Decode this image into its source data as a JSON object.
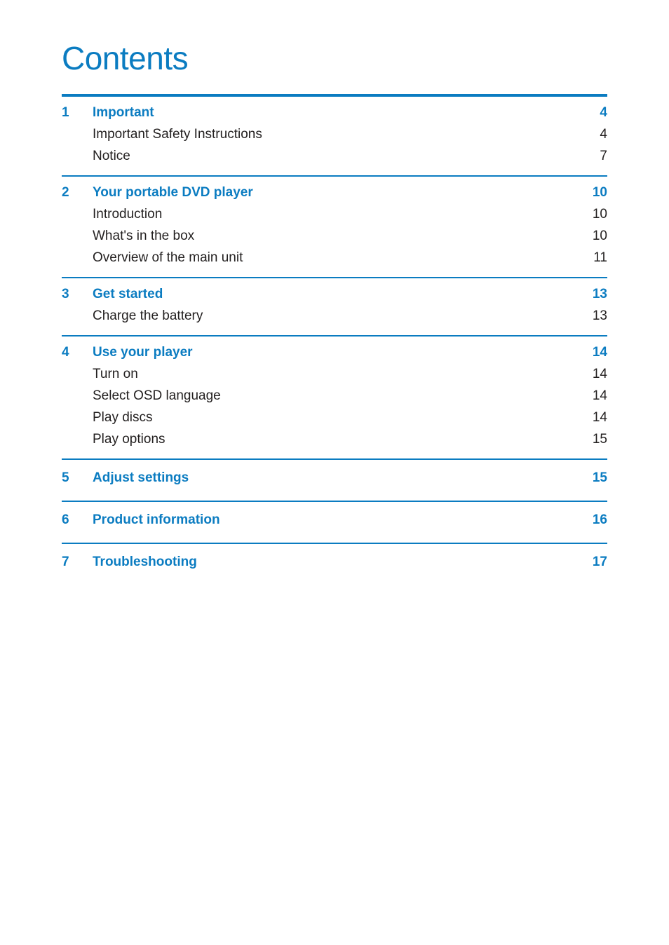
{
  "document": {
    "title": "Contents",
    "accent_color": "#0b7cc1",
    "body_text_color": "#221f1f"
  },
  "toc": {
    "sections": [
      {
        "number": "1",
        "title": "Important",
        "page": "4",
        "items": [
          {
            "label": "Important Safety Instructions",
            "page": "4"
          },
          {
            "label": "Notice",
            "page": "7"
          }
        ]
      },
      {
        "number": "2",
        "title": "Your portable DVD player",
        "page": "10",
        "items": [
          {
            "label": "Introduction",
            "page": "10"
          },
          {
            "label": "What's in the box",
            "page": "10"
          },
          {
            "label": "Overview of the main unit",
            "page": "11"
          }
        ]
      },
      {
        "number": "3",
        "title": "Get started",
        "page": "13",
        "items": [
          {
            "label": "Charge the battery",
            "page": "13"
          }
        ]
      },
      {
        "number": "4",
        "title": "Use your player",
        "page": "14",
        "items": [
          {
            "label": "Turn on",
            "page": "14"
          },
          {
            "label": "Select OSD language",
            "page": "14"
          },
          {
            "label": "Play discs",
            "page": "14"
          },
          {
            "label": "Play options",
            "page": "15"
          }
        ]
      },
      {
        "number": "5",
        "title": "Adjust settings",
        "page": "15",
        "items": []
      },
      {
        "number": "6",
        "title": "Product information",
        "page": "16",
        "items": []
      },
      {
        "number": "7",
        "title": "Troubleshooting",
        "page": "17",
        "items": []
      }
    ]
  }
}
